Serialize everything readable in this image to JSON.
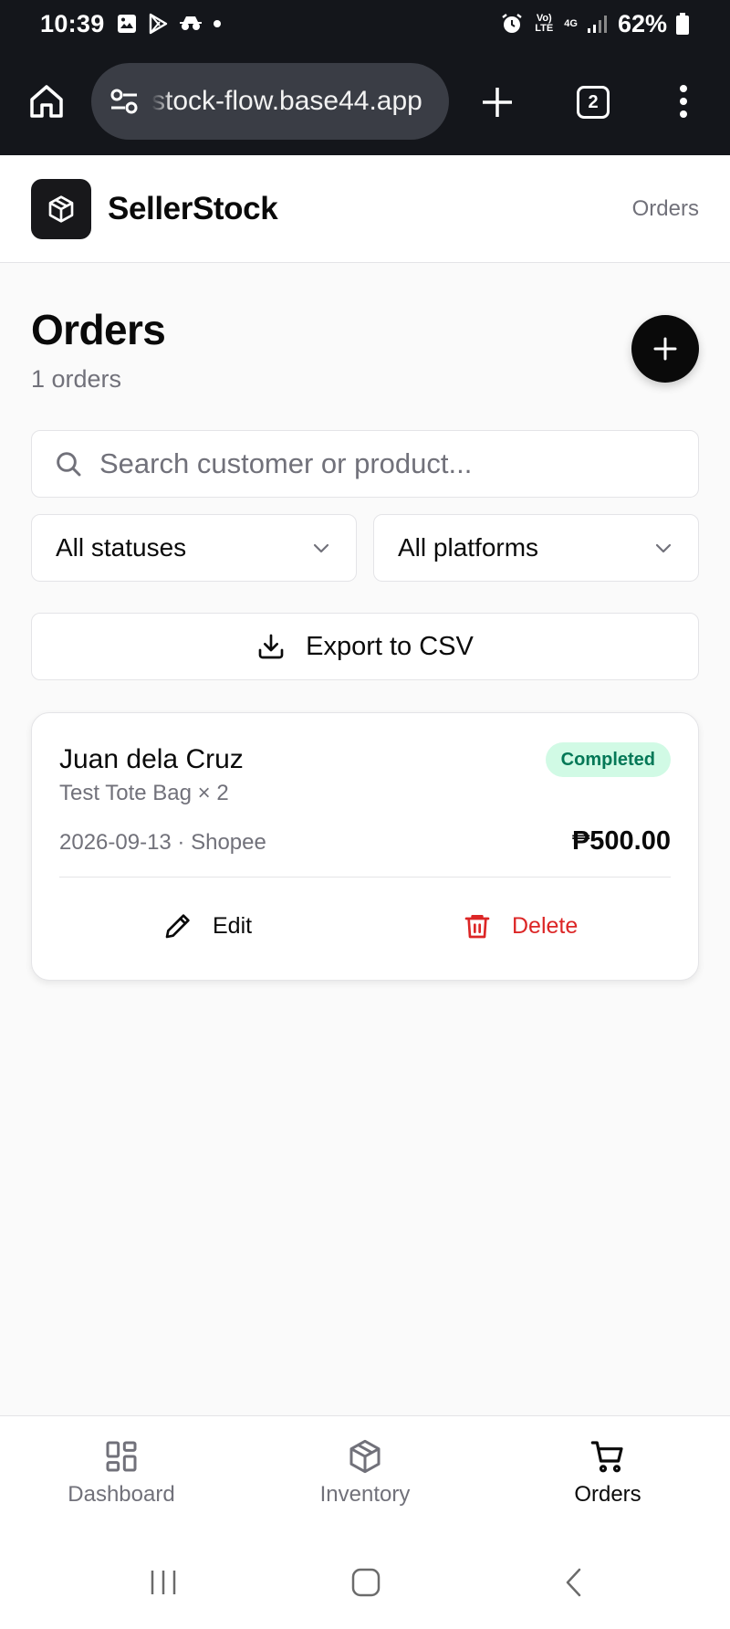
{
  "status_bar": {
    "time": "10:39",
    "network": "Vo) LTE",
    "network_type": "4G",
    "battery": "62%"
  },
  "browser": {
    "url": "stock-flow.base44.app",
    "tab_count": "2"
  },
  "app": {
    "name": "SellerStock",
    "header_link": "Orders"
  },
  "page": {
    "title": "Orders",
    "subtitle": "1 orders"
  },
  "search": {
    "placeholder": "Search customer or product...",
    "value": ""
  },
  "filters": {
    "status": "All statuses",
    "platform": "All platforms"
  },
  "export_label": "Export to CSV",
  "orders": [
    {
      "customer": "Juan dela Cruz",
      "status": "Completed",
      "product_line": "Test Tote Bag × 2",
      "date_platform": "2026-09-13 · Shopee",
      "amount": "₱500.00",
      "edit_label": "Edit",
      "delete_label": "Delete"
    }
  ],
  "nav": {
    "dashboard": "Dashboard",
    "inventory": "Inventory",
    "orders": "Orders",
    "active": "orders"
  },
  "colors": {
    "accent": "#0a0a0a",
    "status_completed_bg": "#d1fae5",
    "status_completed_text": "#047857",
    "danger": "#dc2626",
    "muted": "#71717a"
  }
}
